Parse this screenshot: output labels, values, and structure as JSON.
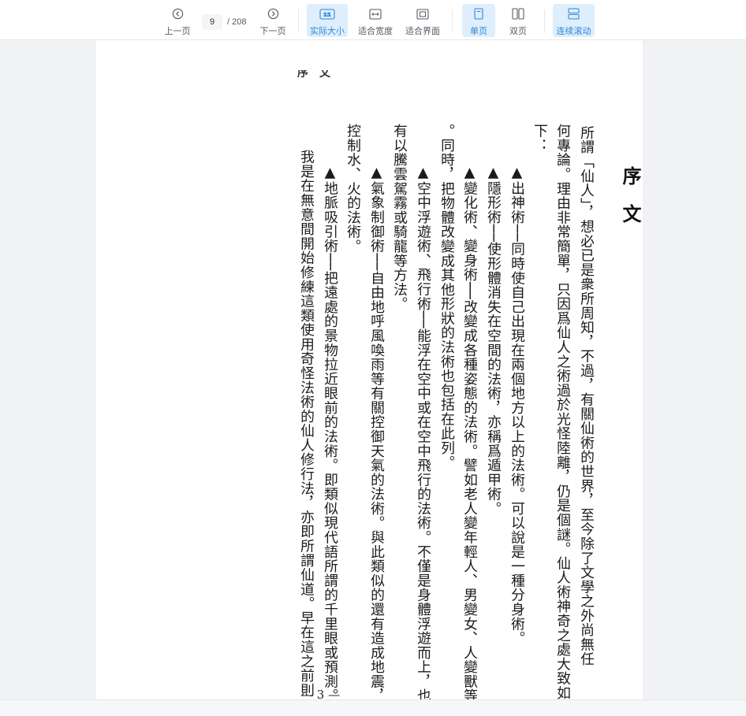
{
  "toolbar": {
    "prev_label": "上一页",
    "next_label": "下一页",
    "current_page": "9",
    "total_pages": "/ 208",
    "actual_size_label": "实际大小",
    "fit_width_label": "适合宽度",
    "fit_page_label": "适合界面",
    "single_page_label": "单页",
    "double_page_label": "双页",
    "continuous_label": "连续滚动",
    "actual_size_icon_text": "1:1",
    "accent_color": "#2f87d6",
    "active_bg_color": "#deeefc"
  },
  "document": {
    "running_header": "序　文",
    "title": "序文",
    "columns": [
      "　所謂「仙人」，想必已是衆所周知，不過，有關仙術的世界，至今除了文學之外尚無任",
      "何專論。理由非常簡單，只因爲仙人之術過於光怪陸離，仍是個謎。仙人術神奇之處大致如",
      "下：",
      "　▲出神術──同時使自己出現在兩個地方以上的法術。可以說是一種分身術。",
      "　▲隱形術──使形體消失在空間的法術，亦稱爲遁甲術。",
      "　▲變化術、變身術──改變成各種姿態的法術。譬如老人變年輕人、男變女、人變獸等",
      "。同時，把物體改變成其他形狀的法術也包括在此列。",
      "　▲空中浮遊術、飛行術──能浮在空中或在空中飛行的法術。不僅是身體浮遊而上，也",
      "有以騰雲駕霧或騎龍等方法。",
      "　▲氣象制御術──自由地呼風喚雨等有關控御天氣的法術。與此類似的還有造成地震，",
      "控制水、火的法術。",
      "　▲地脈吸引術──把遠處的景物拉近眼前的法術。即類似現代語所謂的千里眼或預測。",
      "我是在無意間開始修練這類使用奇怪法術的仙人修行法，亦即所謂仙道。早在這之前則"
    ],
    "page_number": "— 3 —"
  }
}
